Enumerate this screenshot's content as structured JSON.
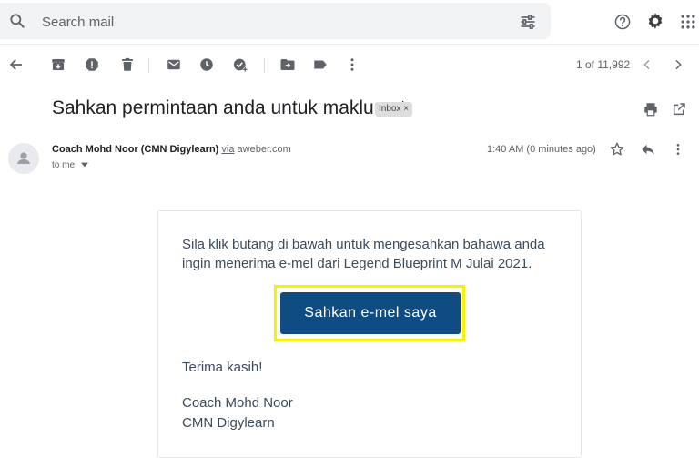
{
  "search": {
    "placeholder": "Search mail"
  },
  "toolbar": {
    "pager_text": "1 of 11,992"
  },
  "email": {
    "subject": "Sahkan permintaan anda untuk maklumat.",
    "label_chip": "Inbox ×",
    "sender_name": "Coach Mohd Noor (CMN Digylearn)",
    "via_word": "via",
    "via_domain": "aweber.com",
    "recipient": "to me",
    "time": "1:40 AM (0 minutes ago)",
    "body_text": "Sila klik butang di bawah untuk mengesahkan bahawa anda ingin menerima e-mel dari Legend Blueprint M Julai 2021.",
    "cta_label": "Sahkan e-mel saya",
    "thanks": "Terima kasih!",
    "signature_name": "Coach Mohd Noor",
    "signature_org": "CMN Digylearn"
  },
  "colors": {
    "cta_background": "#0f4c81",
    "cta_highlight": "#f5f500",
    "body_text": "#3a4b5c",
    "search_background": "#f1f3f4"
  },
  "icons": {
    "top": [
      "search-icon",
      "tune-icon",
      "help-icon",
      "settings-icon",
      "apps-icon"
    ],
    "toolbar": [
      "back-arrow-icon",
      "archive-icon",
      "report-spam-icon",
      "delete-icon",
      "mark-unread-icon",
      "snooze-icon",
      "add-to-tasks-icon",
      "move-to-icon",
      "labels-icon",
      "more-vert-icon",
      "prev-icon",
      "next-icon"
    ],
    "message": [
      "print-icon",
      "open-new-window-icon",
      "avatar-icon",
      "star-icon",
      "reply-icon",
      "more-vert-icon"
    ]
  }
}
